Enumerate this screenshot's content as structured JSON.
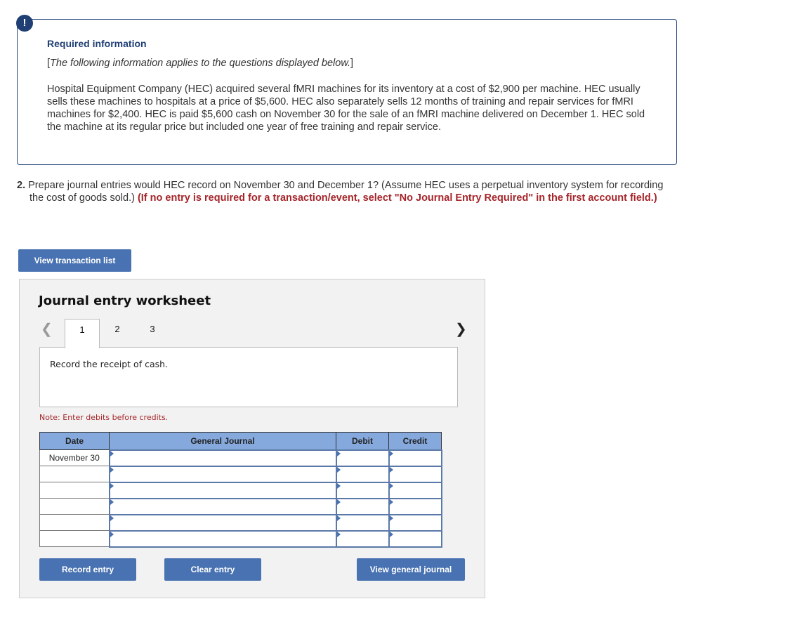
{
  "info": {
    "icon": "exclamation-icon",
    "title": "Required information",
    "subtitle": "The following information applies to the questions displayed below.",
    "body": "Hospital Equipment Company (HEC) acquired several fMRI machines for its inventory at a cost of $2,900 per machine. HEC usually sells these machines to hospitals at a price of $5,600. HEC also separately sells 12 months of training and repair services for fMRI machines for $2,400. HEC is paid $5,600 cash on November 30 for the sale of an fMRI machine delivered on December 1. HEC sold the machine at its regular price but included one year of free training and repair service."
  },
  "question": {
    "number": "2.",
    "text": "Prepare journal entries would HEC record on November 30 and December 1? (Assume HEC uses a perpetual inventory system for recording the cost of goods sold.)",
    "instruction": "(If no entry is required for a transaction/event, select \"No Journal Entry Required\" in the first account field.)"
  },
  "buttons": {
    "view_transaction_list": "View transaction list",
    "record_entry": "Record entry",
    "clear_entry": "Clear entry",
    "view_general_journal": "View general journal"
  },
  "worksheet": {
    "title": "Journal entry worksheet",
    "tabs": [
      "1",
      "2",
      "3"
    ],
    "active_tab": "1",
    "prev_icon": "chevron-left-icon",
    "next_icon": "chevron-right-icon",
    "description": "Record the receipt of cash.",
    "note": "Note: Enter debits before credits."
  },
  "journal": {
    "headers": {
      "date": "Date",
      "general_journal": "General Journal",
      "debit": "Debit",
      "credit": "Credit"
    },
    "rows": [
      {
        "date": "November 30",
        "account": "",
        "debit": "",
        "credit": ""
      },
      {
        "date": "",
        "account": "",
        "debit": "",
        "credit": ""
      },
      {
        "date": "",
        "account": "",
        "debit": "",
        "credit": ""
      },
      {
        "date": "",
        "account": "",
        "debit": "",
        "credit": ""
      },
      {
        "date": "",
        "account": "",
        "debit": "",
        "credit": ""
      },
      {
        "date": "",
        "account": "",
        "debit": "",
        "credit": ""
      }
    ]
  }
}
